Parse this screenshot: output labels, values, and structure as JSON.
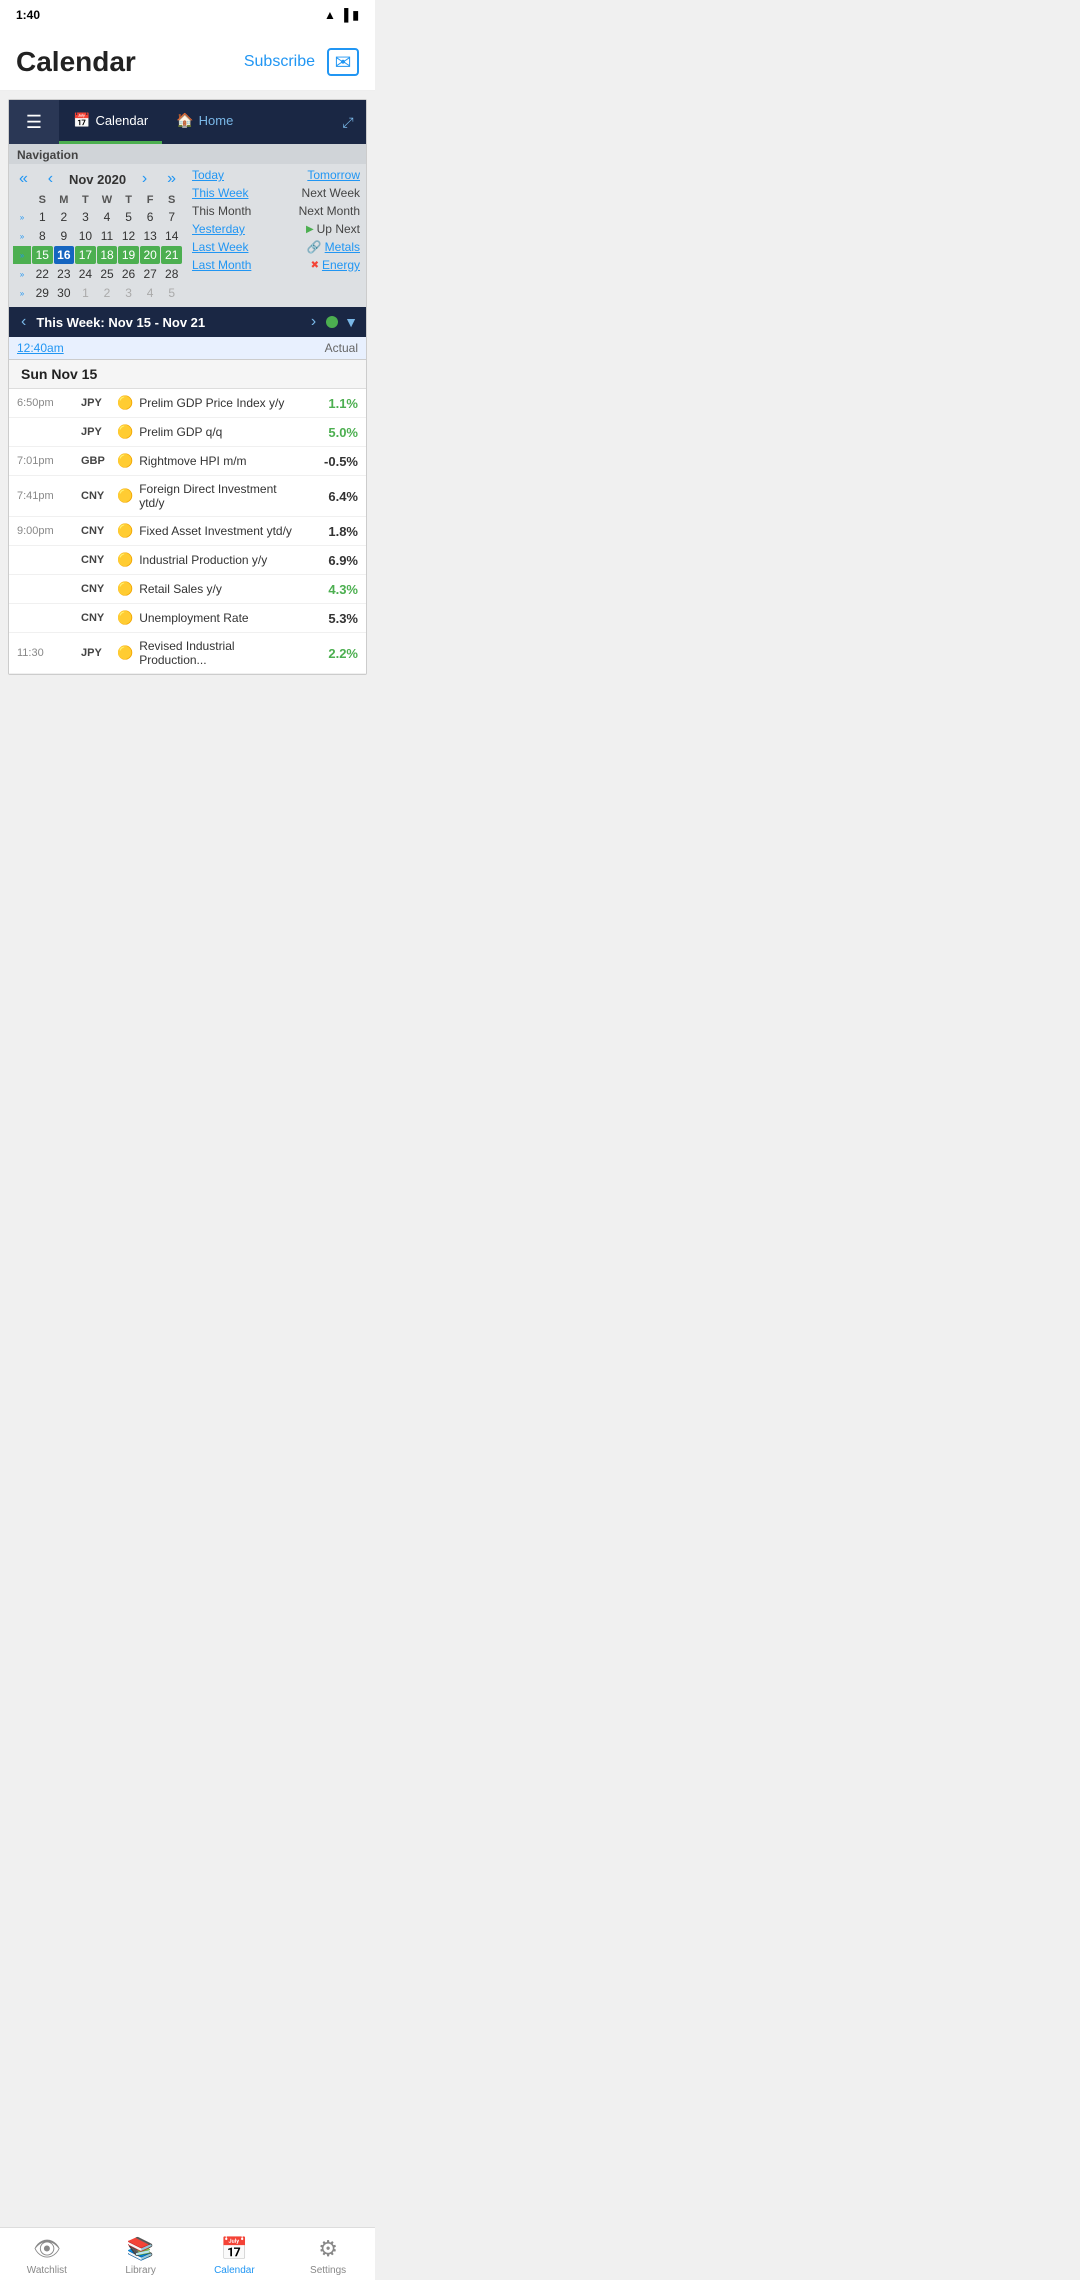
{
  "statusBar": {
    "time": "1:40",
    "wifi": "wifi",
    "signal": "signal",
    "battery": "battery"
  },
  "header": {
    "title": "Calendar",
    "subscribeLabel": "Subscribe",
    "mailIcon": "✉"
  },
  "widget": {
    "tabs": [
      {
        "label": "Calendar",
        "icon": "📅",
        "active": true
      },
      {
        "label": "Home",
        "icon": "🏠",
        "active": false
      }
    ],
    "menuIcon": "☰",
    "expandIcon": "⤢",
    "navLabel": "Navigation",
    "prevMonth": "«",
    "prevWeek": "‹",
    "nextWeek": "›",
    "nextMonth": "»",
    "monthLabel": "Nov  2020",
    "dayHeaders": [
      "S",
      "M",
      "T",
      "W",
      "T",
      "F",
      "S"
    ],
    "weeks": [
      {
        "indicator": "»",
        "highlight": false,
        "days": [
          {
            "n": "1",
            "cls": ""
          },
          {
            "n": "2",
            "cls": ""
          },
          {
            "n": "3",
            "cls": ""
          },
          {
            "n": "4",
            "cls": ""
          },
          {
            "n": "5",
            "cls": ""
          },
          {
            "n": "6",
            "cls": ""
          },
          {
            "n": "7",
            "cls": ""
          }
        ]
      },
      {
        "indicator": "»",
        "highlight": false,
        "days": [
          {
            "n": "8",
            "cls": ""
          },
          {
            "n": "9",
            "cls": ""
          },
          {
            "n": "10",
            "cls": ""
          },
          {
            "n": "11",
            "cls": ""
          },
          {
            "n": "12",
            "cls": ""
          },
          {
            "n": "13",
            "cls": ""
          },
          {
            "n": "14",
            "cls": ""
          }
        ]
      },
      {
        "indicator": "»",
        "highlight": true,
        "days": [
          {
            "n": "15",
            "cls": ""
          },
          {
            "n": "16",
            "cls": "today-bold"
          },
          {
            "n": "17",
            "cls": ""
          },
          {
            "n": "18",
            "cls": ""
          },
          {
            "n": "19",
            "cls": ""
          },
          {
            "n": "20",
            "cls": ""
          },
          {
            "n": "21",
            "cls": ""
          }
        ]
      },
      {
        "indicator": "»",
        "highlight": false,
        "days": [
          {
            "n": "22",
            "cls": ""
          },
          {
            "n": "23",
            "cls": ""
          },
          {
            "n": "24",
            "cls": ""
          },
          {
            "n": "25",
            "cls": ""
          },
          {
            "n": "26",
            "cls": ""
          },
          {
            "n": "27",
            "cls": ""
          },
          {
            "n": "28",
            "cls": ""
          }
        ]
      },
      {
        "indicator": "»",
        "highlight": false,
        "days": [
          {
            "n": "29",
            "cls": ""
          },
          {
            "n": "30",
            "cls": ""
          },
          {
            "n": "1",
            "cls": "other-month"
          },
          {
            "n": "2",
            "cls": "other-month"
          },
          {
            "n": "3",
            "cls": "other-month"
          },
          {
            "n": "4",
            "cls": "other-month"
          },
          {
            "n": "5",
            "cls": "other-month"
          }
        ]
      }
    ],
    "quickLinks": {
      "rows": [
        [
          {
            "label": "Today",
            "underline": true,
            "cls": ""
          },
          {
            "label": "Tomorrow",
            "underline": false,
            "cls": ""
          }
        ],
        [
          {
            "label": "This Week",
            "underline": true,
            "cls": ""
          },
          {
            "label": "Next Week",
            "underline": false,
            "cls": "no-underline"
          }
        ],
        [
          {
            "label": "This Month",
            "underline": false,
            "cls": "no-underline"
          },
          {
            "label": "Next Month",
            "underline": false,
            "cls": "no-underline"
          }
        ],
        [
          {
            "label": "Yesterday",
            "underline": true,
            "cls": ""
          },
          {
            "label": "Up Next",
            "underline": false,
            "cls": "",
            "prefix": "▶",
            "prefixCls": "ql-icon-green"
          }
        ],
        [
          {
            "label": "Last Week",
            "underline": true,
            "cls": ""
          },
          {
            "label": "Metals",
            "underline": true,
            "cls": "metals",
            "prefix": "🔗",
            "prefixCls": ""
          }
        ],
        [
          {
            "label": "Last Month",
            "underline": true,
            "cls": ""
          },
          {
            "label": "Energy",
            "underline": true,
            "cls": "energy",
            "prefix": "✖",
            "prefixCls": "ql-icon-red"
          }
        ]
      ]
    }
  },
  "weekNavBar": {
    "prevBtn": "‹",
    "nextBtn": "›",
    "label": "This Week: Nov 15 - Nov 21",
    "greenDot": true,
    "filterIcon": "▼"
  },
  "timeActual": {
    "time": "12:40am",
    "label": "Actual"
  },
  "eventDateHeader": "Sun Nov 15",
  "events": [
    {
      "time": "6:50pm",
      "currency": "JPY",
      "impact": "🟡",
      "name": "Prelim GDP Price Index y/y",
      "value": "1.1%",
      "valueCls": "positive"
    },
    {
      "time": "",
      "currency": "JPY",
      "impact": "🟡",
      "name": "Prelim GDP q/q",
      "value": "5.0%",
      "valueCls": "positive"
    },
    {
      "time": "7:01pm",
      "currency": "GBP",
      "impact": "🟡",
      "name": "Rightmove HPI m/m",
      "value": "-0.5%",
      "valueCls": "neutral"
    },
    {
      "time": "7:41pm",
      "currency": "CNY",
      "impact": "🟡",
      "name": "Foreign Direct Investment ytd/y",
      "value": "6.4%",
      "valueCls": "neutral"
    },
    {
      "time": "9:00pm",
      "currency": "CNY",
      "impact": "🟡",
      "name": "Fixed Asset Investment ytd/y",
      "value": "1.8%",
      "valueCls": "neutral"
    },
    {
      "time": "",
      "currency": "CNY",
      "impact": "🟡",
      "name": "Industrial Production y/y",
      "value": "6.9%",
      "valueCls": "neutral"
    },
    {
      "time": "",
      "currency": "CNY",
      "impact": "🟡",
      "name": "Retail Sales y/y",
      "value": "4.3%",
      "valueCls": "positive"
    },
    {
      "time": "",
      "currency": "CNY",
      "impact": "🟡",
      "name": "Unemployment Rate",
      "value": "5.3%",
      "valueCls": "neutral"
    },
    {
      "time": "11:30",
      "currency": "JPY",
      "impact": "🟡",
      "name": "Revised Industrial Production...",
      "value": "2.2%",
      "valueCls": "positive"
    }
  ],
  "bottomNav": {
    "items": [
      {
        "icon": "👁",
        "label": "Watchlist",
        "active": false
      },
      {
        "icon": "📚",
        "label": "Library",
        "active": false
      },
      {
        "icon": "📅",
        "label": "Calendar",
        "active": true
      },
      {
        "icon": "⚙",
        "label": "Settings",
        "active": false
      }
    ]
  },
  "systemNav": {
    "backIcon": "◀",
    "homeIcon": "●",
    "recentIcon": "■"
  }
}
